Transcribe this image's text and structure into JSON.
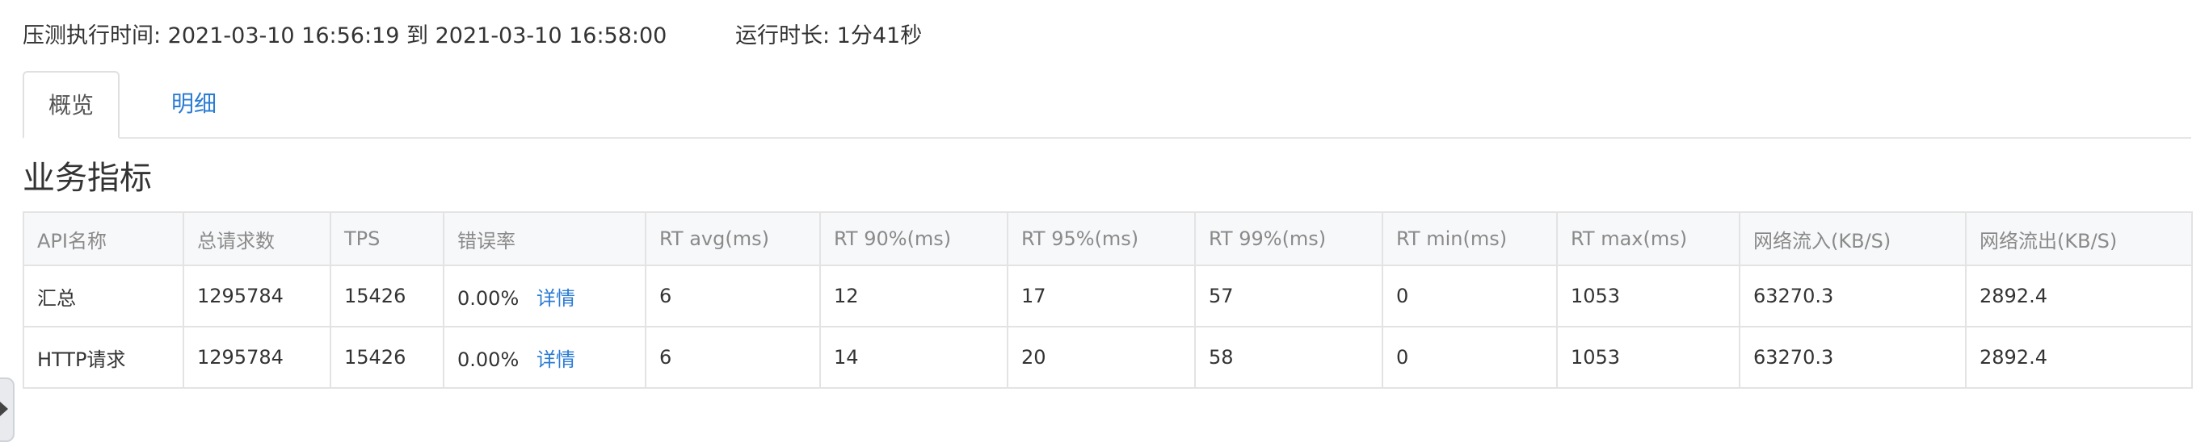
{
  "header": {
    "exec_time": "压测执行时间: 2021-03-10 16:56:19 到 2021-03-10 16:58:00",
    "duration": "运行时长: 1分41秒"
  },
  "tabs": [
    {
      "label": "概览",
      "active": true
    },
    {
      "label": "明细",
      "active": false
    }
  ],
  "section_title": "业务指标",
  "table": {
    "headers": [
      "API名称",
      "总请求数",
      "TPS",
      "错误率",
      "RT avg(ms)",
      "RT 90%(ms)",
      "RT 95%(ms)",
      "RT 99%(ms)",
      "RT min(ms)",
      "RT max(ms)",
      "网络流入(KB/S)",
      "网络流出(KB/S)"
    ],
    "rows": [
      {
        "name": "汇总",
        "total": "1295784",
        "tps": "15426",
        "error_rate": "0.00%",
        "detail": "详情",
        "rt_avg": "6",
        "rt_90": "12",
        "rt_95": "17",
        "rt_99": "57",
        "rt_min": "0",
        "rt_max": "1053",
        "net_in": "63270.3",
        "net_out": "2892.4"
      },
      {
        "name": "HTTP请求",
        "total": "1295784",
        "tps": "15426",
        "error_rate": "0.00%",
        "detail": "详情",
        "rt_avg": "6",
        "rt_90": "14",
        "rt_95": "20",
        "rt_99": "58",
        "rt_min": "0",
        "rt_max": "1053",
        "net_in": "63270.3",
        "net_out": "2892.4"
      }
    ]
  },
  "colors": {
    "link": "#2b7cd3",
    "header_bg": "#f7f8fa",
    "border": "#e3e3e3"
  },
  "icons": {
    "side_handle": "chevron-right-icon"
  }
}
